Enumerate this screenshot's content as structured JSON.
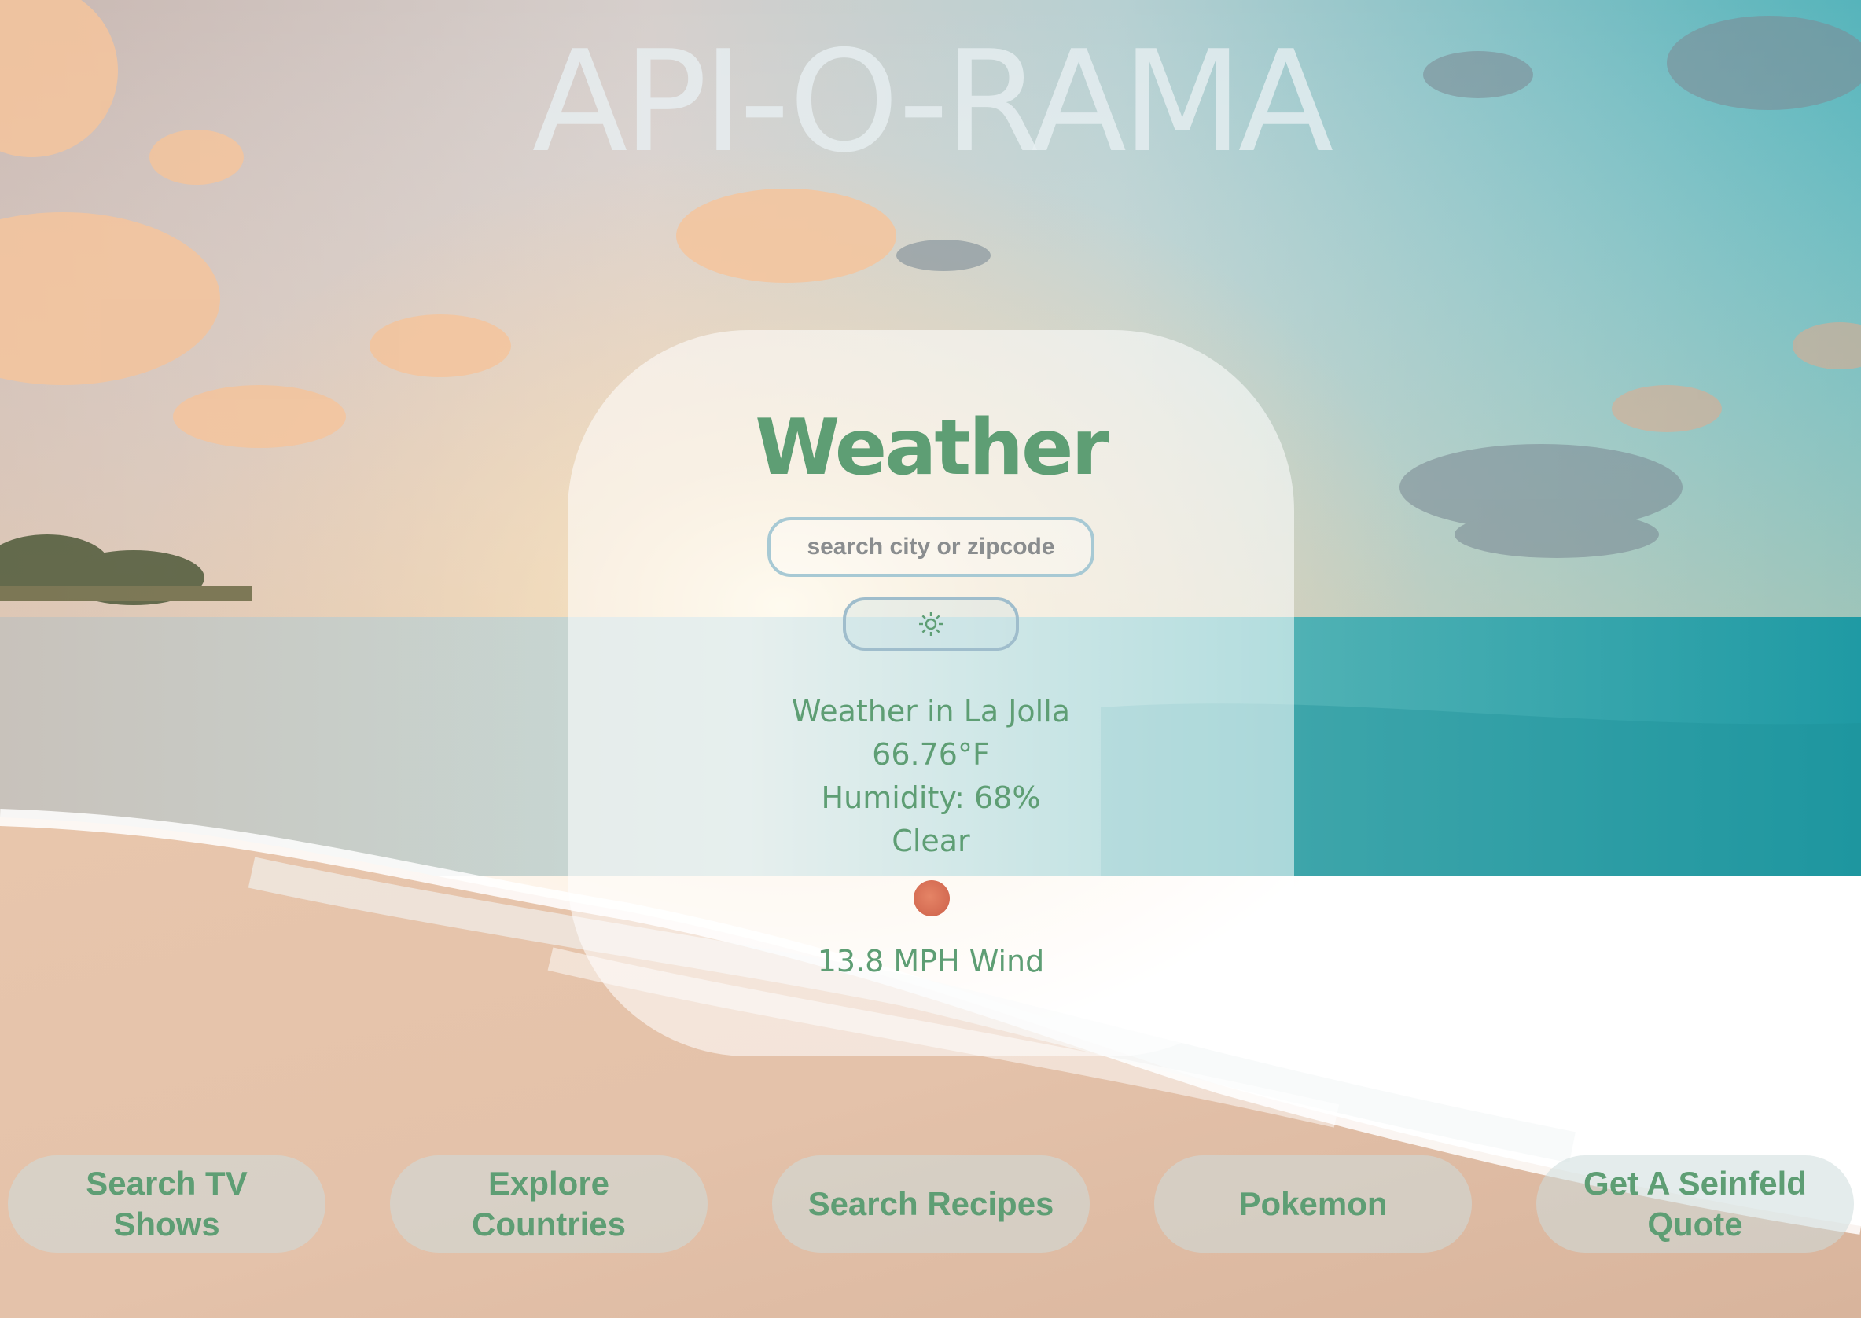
{
  "colors": {
    "accent_green": "#5e9e74",
    "weather_icon": "#d46b52"
  },
  "site": {
    "title": "API-O-RAMA"
  },
  "weather": {
    "heading": "Weather",
    "search": {
      "placeholder": "search city or zipcode",
      "value": ""
    },
    "submit_icon": "sun-icon",
    "location_line": "Weather in La Jolla",
    "temperature": "66.76°F",
    "humidity": "Humidity: 68%",
    "condition": "Clear",
    "condition_icon": "clear-sky-icon",
    "wind": "13.8 MPH Wind"
  },
  "nav": [
    {
      "label": "Search TV Shows"
    },
    {
      "label": "Explore Countries"
    },
    {
      "label": "Search Recipes"
    },
    {
      "label": "Pokemon"
    },
    {
      "label": "Get A Seinfeld Quote"
    }
  ]
}
